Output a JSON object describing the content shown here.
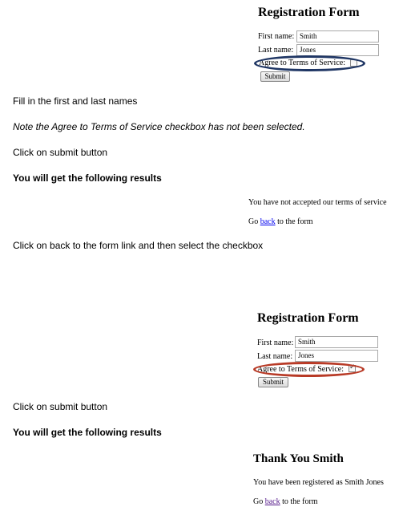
{
  "form1": {
    "title": "Registration Form",
    "first_name_label": "First name:",
    "first_name_value": "Smith",
    "last_name_label": "Last name:",
    "last_name_value": "Jones",
    "agree_label": "Agree to Terms of Service:",
    "agree_checked": false,
    "submit_label": "Submit"
  },
  "steps": {
    "step1": "Fill in the first and last names",
    "note": "Note the Agree to Terms of Service checkbox has not been selected.",
    "step2": "Click on submit button",
    "results1_heading": "You will get the following results",
    "step3": "Click on back to the form link and then select the checkbox",
    "step4": "Click on submit button",
    "results2_heading": "You will get the following results"
  },
  "result1": {
    "message": "You have not accepted our terms of service",
    "go_text": "Go",
    "back_link": "back",
    "to_form_text": "to the form"
  },
  "form2": {
    "title": "Registration Form",
    "first_name_label": "First name:",
    "first_name_value": "Smith",
    "last_name_label": "Last name:",
    "last_name_value": "Jones",
    "agree_label": "Agree to Terms of Service:",
    "agree_checked": true,
    "submit_label": "Submit"
  },
  "result2": {
    "heading": "Thank You Smith",
    "message": "You have been registered as Smith Jones",
    "go_text": "Go",
    "back_link": "back",
    "to_form_text": "to the form"
  },
  "colors": {
    "highlight_unchecked": "#1f3664",
    "highlight_checked": "#b83a26",
    "link": "#0000ee",
    "visited_link": "#551a8b"
  }
}
